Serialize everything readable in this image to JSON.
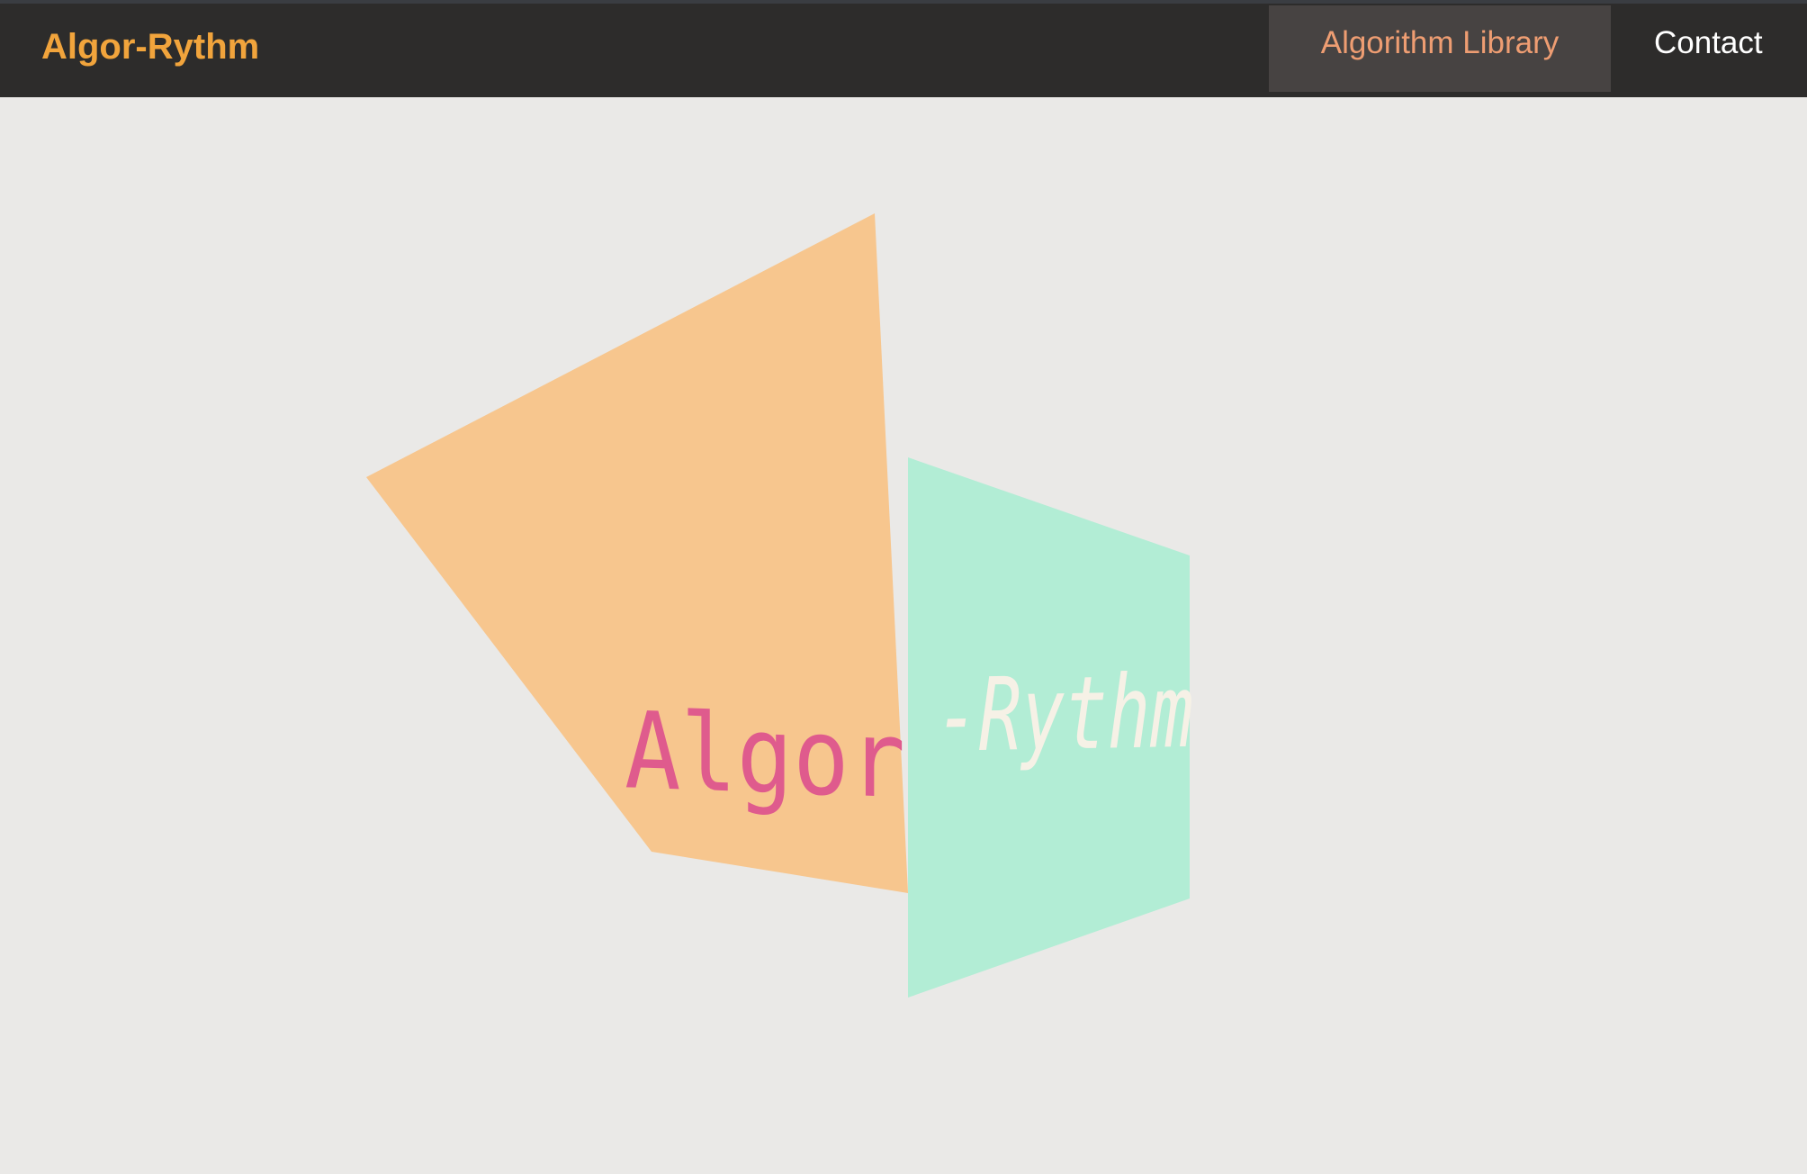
{
  "header": {
    "brand": "Algor-Rythm",
    "nav": {
      "library_label": "Algorithm Library",
      "contact_label": "Contact"
    }
  },
  "hero": {
    "title_left": "Algor",
    "title_right": "-Rythm"
  },
  "colors": {
    "topbar_bg": "#2d2c2b",
    "brand": "#f1a43c",
    "nav_active_bg": "#474342",
    "nav_active_text": "#ee9d72",
    "page_bg": "#eae9e7",
    "panel_left": "#f7c68e",
    "panel_right": "#b2edd5",
    "title_left_color": "#df5b8d",
    "title_right_color": "#f6f1e6"
  }
}
